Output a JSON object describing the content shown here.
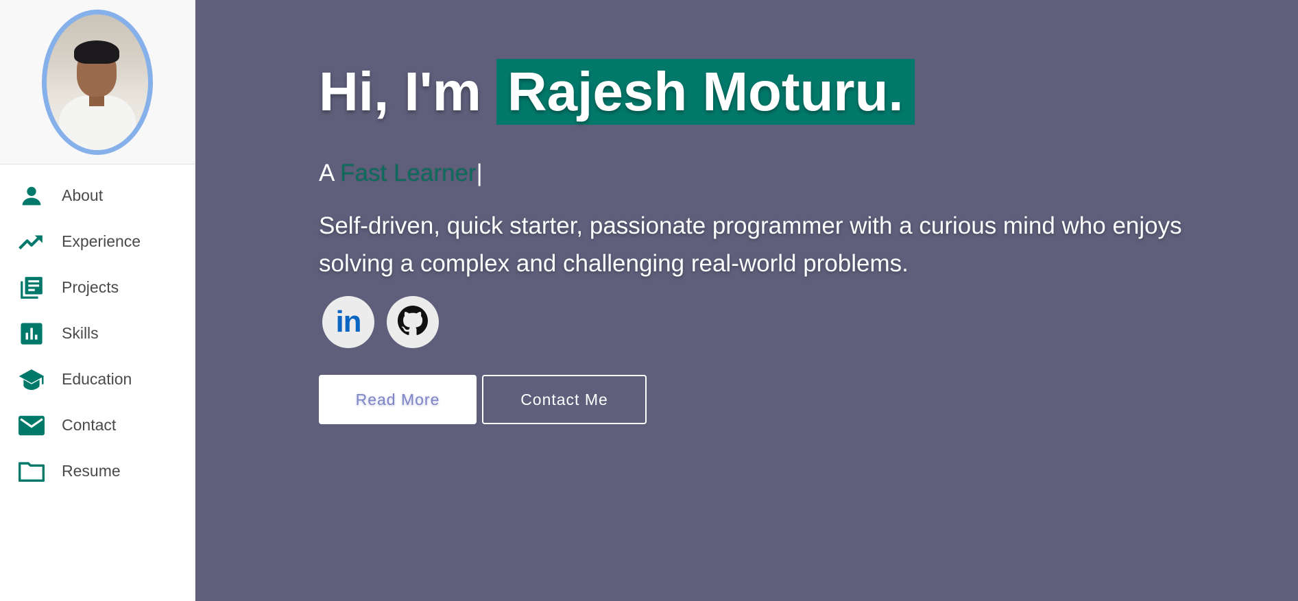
{
  "sidebar": {
    "items": [
      {
        "label": "About",
        "icon": "person-icon"
      },
      {
        "label": "Experience",
        "icon": "trending-up-icon"
      },
      {
        "label": "Projects",
        "icon": "library-books-icon"
      },
      {
        "label": "Skills",
        "icon": "bar-chart-icon"
      },
      {
        "label": "Education",
        "icon": "graduation-cap-icon"
      },
      {
        "label": "Contact",
        "icon": "mail-icon"
      },
      {
        "label": "Resume",
        "icon": "folder-icon"
      }
    ]
  },
  "hero": {
    "greeting": "Hi, I'm",
    "name": "Rajesh Moturu.",
    "tagline_prefix": "A",
    "tagline_typed": "Fast Learner",
    "tagline_cursor": "|",
    "bio": "Self-driven, quick starter, passionate programmer with a curious mind who enjoys solving a complex and challenging real-world problems.",
    "socials": [
      {
        "label": "in",
        "icon": "linkedin-icon"
      },
      {
        "label": "",
        "icon": "github-icon"
      }
    ],
    "read_more_label": "Read More",
    "contact_label": "Contact Me"
  },
  "colors": {
    "accent": "#00796b",
    "background": "#5f5f7b",
    "avatar_border": "#86b0ea",
    "read_more_text": "#7f86c5"
  }
}
